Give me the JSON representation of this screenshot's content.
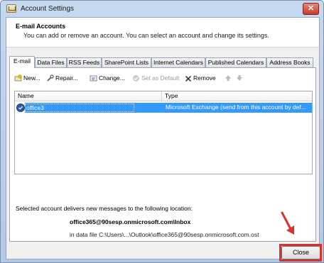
{
  "window": {
    "title": "Account Settings",
    "close_glyph": "✕"
  },
  "header": {
    "title": "E-mail Accounts",
    "subtitle": "You can add or remove an account. You can select an account and change its settings."
  },
  "tabs": [
    {
      "label": "E-mail"
    },
    {
      "label": "Data Files"
    },
    {
      "label": "RSS Feeds"
    },
    {
      "label": "SharePoint Lists"
    },
    {
      "label": "Internet Calendars"
    },
    {
      "label": "Published Calendars"
    },
    {
      "label": "Address Books"
    }
  ],
  "toolbar": {
    "new_label": "New...",
    "repair_label": "Repair...",
    "change_label": "Change...",
    "set_default_label": "Set as Default",
    "remove_label": "Remove"
  },
  "list": {
    "columns": [
      "Name",
      "Type"
    ],
    "rows": [
      {
        "name": "office3",
        "type": "Microsoft Exchange (send from this account by def..."
      }
    ]
  },
  "location": {
    "label": "Selected account delivers new messages to the following location:",
    "path": "office365@90sesp.onmicrosoft.com\\Inbox",
    "file": "in data file C:\\Users\\...\\Outlook\\office365@90sesp.onmicrosoft.com.ost"
  },
  "buttons": {
    "close_label": "Close"
  },
  "colors": {
    "selection": "#3399ff",
    "highlight": "#d9342b"
  }
}
